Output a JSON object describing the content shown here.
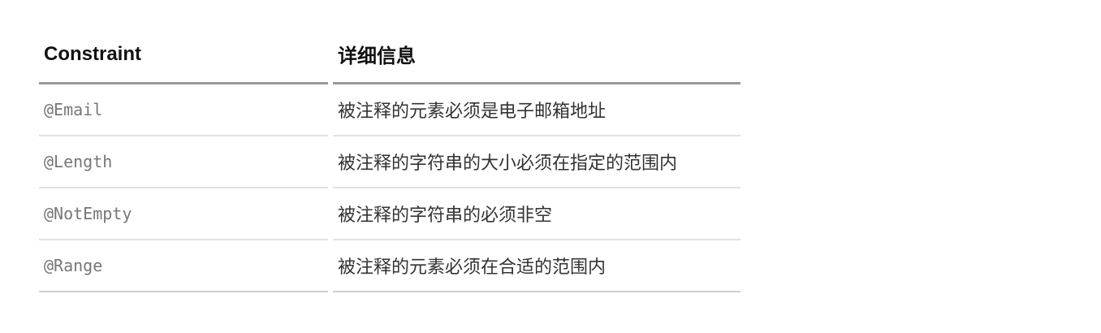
{
  "table": {
    "headers": {
      "constraint": "Constraint",
      "details": "详细信息"
    },
    "rows": [
      {
        "constraint": "@Email",
        "details": "被注释的元素必须是电子邮箱地址"
      },
      {
        "constraint": "@Length",
        "details": "被注释的字符串的大小必须在指定的范围内"
      },
      {
        "constraint": "@NotEmpty",
        "details": "被注释的字符串的必须非空"
      },
      {
        "constraint": "@Range",
        "details": "被注释的元素必须在合适的范围内"
      }
    ]
  }
}
